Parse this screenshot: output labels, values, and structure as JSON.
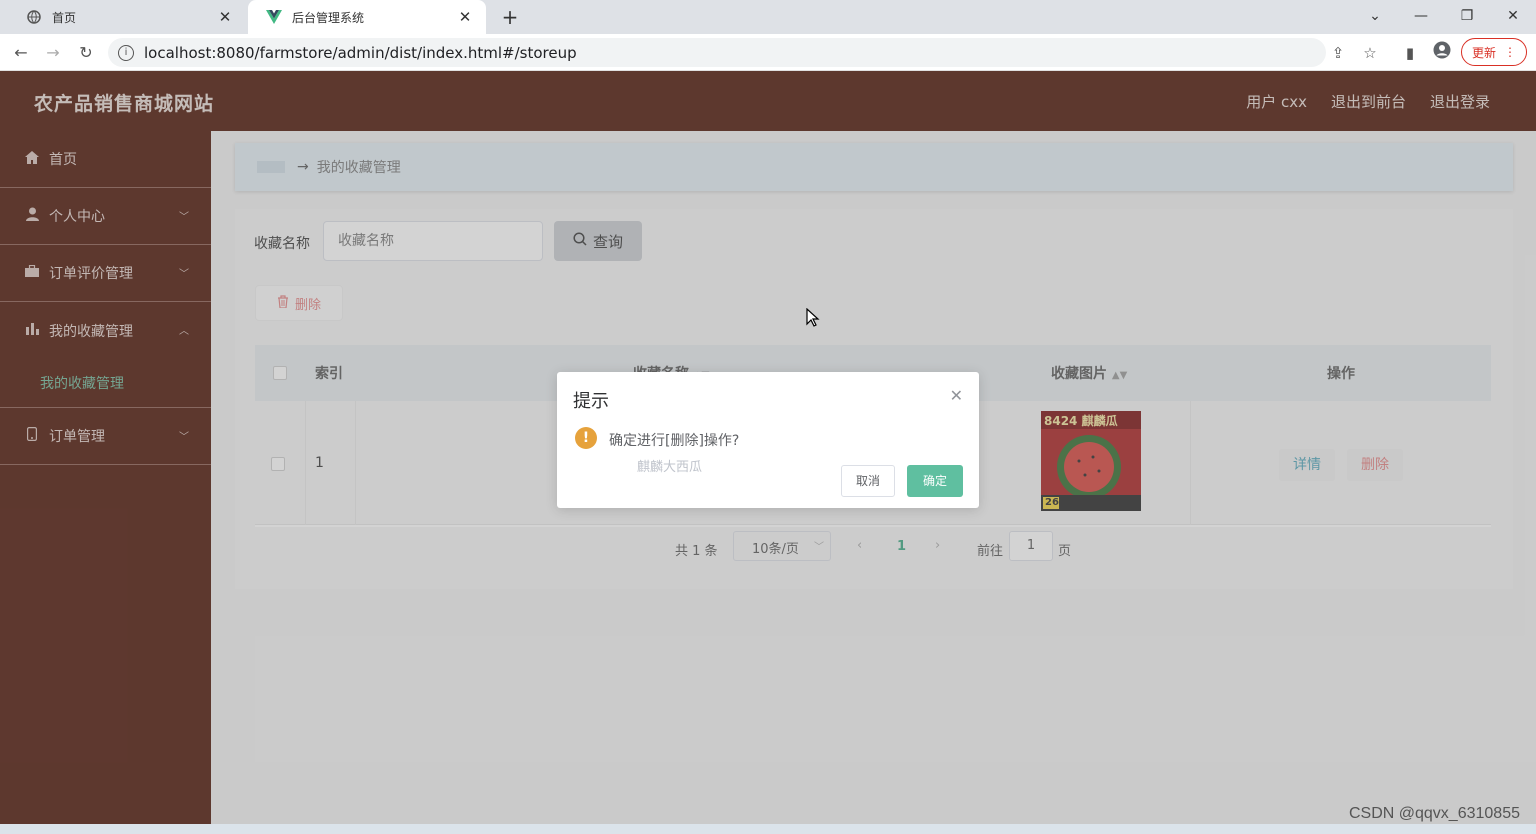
{
  "browser": {
    "tabs": [
      {
        "title": "首页",
        "icon": "globe-icon"
      },
      {
        "title": "后台管理系统",
        "icon": "vue-logo-icon"
      }
    ],
    "new_tab": "+",
    "url": "localhost:8080/farmstore/admin/dist/index.html#/storeup",
    "update_label": "更新"
  },
  "header": {
    "brand": "农产品销售商城网站",
    "user": "用户 cxx",
    "to_front": "退出到前台",
    "logout": "退出登录"
  },
  "sidebar": {
    "items": [
      {
        "label": "首页",
        "icon": "home-icon"
      },
      {
        "label": "个人中心",
        "icon": "user-icon",
        "expanded": false
      },
      {
        "label": "订单评价管理",
        "icon": "briefcase-icon",
        "expanded": false
      },
      {
        "label": "我的收藏管理",
        "icon": "bar-chart-icon",
        "expanded": true
      },
      {
        "label": "订单管理",
        "icon": "phone-icon",
        "expanded": false
      }
    ],
    "subitems": {
      "favorites": "我的收藏管理"
    }
  },
  "breadcrumb": {
    "current": "我的收藏管理"
  },
  "search": {
    "label": "收藏名称",
    "placeholder": "收藏名称",
    "button": "查询"
  },
  "toolbar": {
    "delete": "删除"
  },
  "table": {
    "headers": [
      "索引",
      "收藏名称",
      "收藏图片",
      "操作"
    ],
    "rows": [
      {
        "index": "1",
        "image_text": "8424 麒麟瓜",
        "image_badge": "26",
        "actions": [
          "详情",
          "删除"
        ]
      }
    ]
  },
  "pagination": {
    "total": "共 1 条",
    "page_size": "10条/页",
    "current_page": "1",
    "goto_label": "前往",
    "goto_value": "1",
    "page_unit": "页"
  },
  "dialog": {
    "title": "提示",
    "message": "确定进行[删除]操作?",
    "sub": "麒麟大西瓜",
    "cancel": "取消",
    "confirm": "确定"
  },
  "watermark": "CSDN @qqvx_6310855",
  "colors": {
    "header_bg": "#4a1103",
    "accent_green": "#5fbfa0",
    "danger": "#e58080",
    "warning": "#e6a23c"
  }
}
